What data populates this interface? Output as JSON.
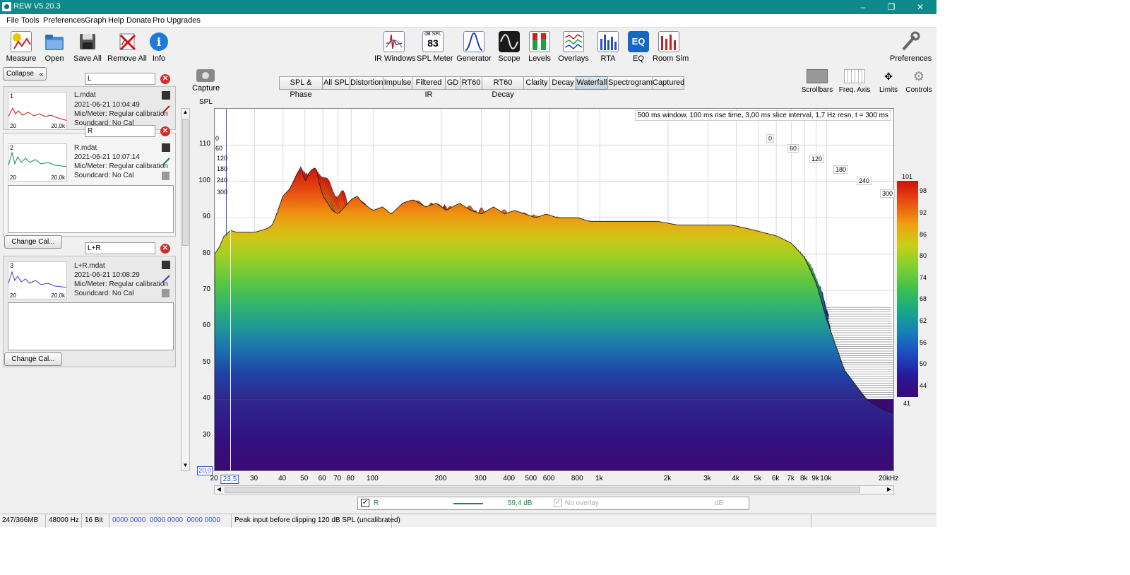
{
  "window": {
    "title": "REW V5.20.3",
    "controls": [
      "–",
      "❐",
      "✕"
    ]
  },
  "menu": [
    "File",
    "Tools",
    "Preferences",
    "Graph",
    "Help",
    "Donate",
    "Pro Upgrades"
  ],
  "toolbar_left": [
    {
      "label": "Measure",
      "icon": "measure-icon"
    },
    {
      "label": "Open",
      "icon": "folder-icon"
    },
    {
      "label": "Save All",
      "icon": "save-icon"
    },
    {
      "label": "Remove All",
      "icon": "remove-icon"
    },
    {
      "label": "Info",
      "icon": "info-icon"
    }
  ],
  "toolbar_center": [
    {
      "label": "IR Windows",
      "icon": "ir-windows-icon"
    },
    {
      "label": "SPL Meter",
      "icon": "spl-meter-icon",
      "badge_top": "dB SPL",
      "badge_value": "83"
    },
    {
      "label": "Generator",
      "icon": "generator-icon"
    },
    {
      "label": "Scope",
      "icon": "scope-icon"
    },
    {
      "label": "Levels",
      "icon": "levels-icon"
    },
    {
      "label": "Overlays",
      "icon": "overlays-icon"
    },
    {
      "label": "RTA",
      "icon": "rta-icon"
    },
    {
      "label": "EQ",
      "icon": "eq-icon",
      "badge_value": "EQ"
    },
    {
      "label": "Room Sim",
      "icon": "room-sim-icon"
    }
  ],
  "preferences_label": "Preferences",
  "collapse_label": "Collapse",
  "measurements": [
    {
      "num": "1",
      "name": "L",
      "file": "L.mdat",
      "date": "2021-06-21 10:04:49",
      "mic": "Mic/Meter: Regular calibration",
      "sound": "Soundcard: No Cal",
      "color": "#c01818",
      "thumb_min": "20",
      "thumb_max": "20,0k"
    },
    {
      "num": "2",
      "name": "R",
      "file": "R.mdat",
      "date": "2021-06-21 10:07:14",
      "mic": "Mic/Meter: Regular calibration",
      "sound": "Soundcard: No Cal",
      "color": "#138a4a",
      "thumb_min": "20",
      "thumb_max": "20,0k"
    },
    {
      "num": "3",
      "name": "L+R",
      "file": "L+R.mdat",
      "date": "2021-06-21 10:08:29",
      "mic": "Mic/Meter: Regular calibration",
      "sound": "Soundcard: No Cal",
      "color": "#3a3ac8",
      "thumb_min": "20",
      "thumb_max": "20,0k"
    }
  ],
  "change_cal_label": "Change Cal...",
  "capture_label": "Capture",
  "tabs": [
    {
      "label": "SPL & Phase",
      "active": false
    },
    {
      "label": "All SPL",
      "active": false
    },
    {
      "label": "Distortion",
      "active": false
    },
    {
      "label": "Impulse",
      "active": false
    },
    {
      "label": "Filtered IR",
      "active": false
    },
    {
      "label": "GD",
      "active": false
    },
    {
      "label": "RT60",
      "active": false
    },
    {
      "label": "RT60 Decay",
      "active": false
    },
    {
      "label": "Clarity",
      "active": false
    },
    {
      "label": "Decay",
      "active": false
    },
    {
      "label": "Waterfall",
      "active": true
    },
    {
      "label": "Spectrogram",
      "active": false
    },
    {
      "label": "Captured",
      "active": false
    }
  ],
  "right_controls": [
    {
      "label": "Scrollbars",
      "icon": "scrollbars-icon"
    },
    {
      "label": "Freq. Axis",
      "icon": "freq-axis-icon"
    },
    {
      "label": "Limits",
      "icon": "limits-icon"
    },
    {
      "label": "Controls",
      "icon": "controls-gear-icon"
    }
  ],
  "chart_data": {
    "type": "waterfall",
    "annotation": "500 ms window, 100 ms rise time, 3,00 ms slice interval, 1,7 Hz resn, t = 300 ms",
    "ylabel": "SPL",
    "ylim": [
      20,
      120
    ],
    "y_ticks": [
      "110",
      "100",
      "90",
      "80",
      "70",
      "60",
      "50",
      "40",
      "30"
    ],
    "y_min_label": "20,0",
    "x_ticks": [
      "20",
      "30",
      "40",
      "50",
      "60",
      "70",
      "80",
      "100",
      "200",
      "300",
      "400",
      "500",
      "600",
      "800",
      "1k",
      "2k",
      "3k",
      "4k",
      "5k",
      "6k",
      "7k",
      "8k",
      "9k",
      "10k",
      "20kHz"
    ],
    "x_ticks_hz": [
      20,
      30,
      40,
      50,
      60,
      70,
      80,
      100,
      200,
      300,
      400,
      500,
      600,
      800,
      1000,
      2000,
      3000,
      4000,
      5000,
      6000,
      7000,
      8000,
      9000,
      10000,
      20000
    ],
    "x_scale": "log",
    "xlim": [
      20,
      20000
    ],
    "cursor_label": "23,5",
    "time_axis_labels": [
      "0",
      "60",
      "120",
      "180",
      "240",
      "300"
    ],
    "time_axis_left_labels": [
      "0",
      "60",
      "120",
      "180",
      "240",
      "300"
    ],
    "colorbar": {
      "max_label": "101",
      "min_label": "41",
      "ticks": [
        "98",
        "92",
        "86",
        "80",
        "74",
        "68",
        "62",
        "56",
        "50",
        "44"
      ]
    },
    "front_slice": {
      "freqs": [
        20,
        21,
        22,
        23,
        23.5,
        25,
        28,
        30,
        32,
        34,
        36,
        38,
        40,
        43,
        46,
        48,
        50,
        53,
        56,
        58,
        60,
        63,
        66,
        70,
        75,
        80,
        85,
        90,
        100,
        110,
        120,
        135,
        150,
        170,
        190,
        210,
        240,
        270,
        300,
        340,
        380,
        420,
        470,
        520,
        580,
        650,
        720,
        800,
        900,
        1000,
        1200,
        1500,
        1800,
        2200,
        2700,
        3200,
        3800,
        4500,
        5200,
        6000,
        7000,
        8000,
        9000,
        10000,
        12000,
        15000,
        18000,
        20000
      ],
      "spl": [
        80,
        82,
        85,
        86,
        86.5,
        86,
        86,
        86,
        86.5,
        87,
        88,
        92,
        96,
        98,
        102,
        104,
        100,
        103,
        104,
        99,
        96,
        94,
        92,
        91,
        93,
        95,
        96,
        94,
        92,
        93,
        91,
        94,
        95,
        93,
        94,
        92,
        94,
        92,
        91,
        93,
        91,
        92,
        91,
        90,
        91,
        90,
        90,
        90,
        89,
        89,
        89,
        89,
        89,
        88,
        88,
        88,
        88,
        87,
        86,
        85,
        83,
        79,
        72,
        62,
        48,
        40,
        37,
        36
      ]
    },
    "colors": [
      "#3a0a72",
      "#261a9c",
      "#1c4cc0",
      "#1680b8",
      "#18a888",
      "#3ec050",
      "#7ed030",
      "#c8d018",
      "#f0a010",
      "#e85010",
      "#d01010"
    ]
  },
  "legend_bar": {
    "checked": true,
    "series": "R",
    "value": "59,4 dB",
    "overlay": "No overlay",
    "overlay_unit": "dB"
  },
  "statusbar": [
    "247/366MB",
    "48000 Hz",
    "16 Bit",
    "0000 0000  0000 0000  0000 0000",
    "Peak input before clipping 120 dB SPL (uncalibrated)"
  ]
}
